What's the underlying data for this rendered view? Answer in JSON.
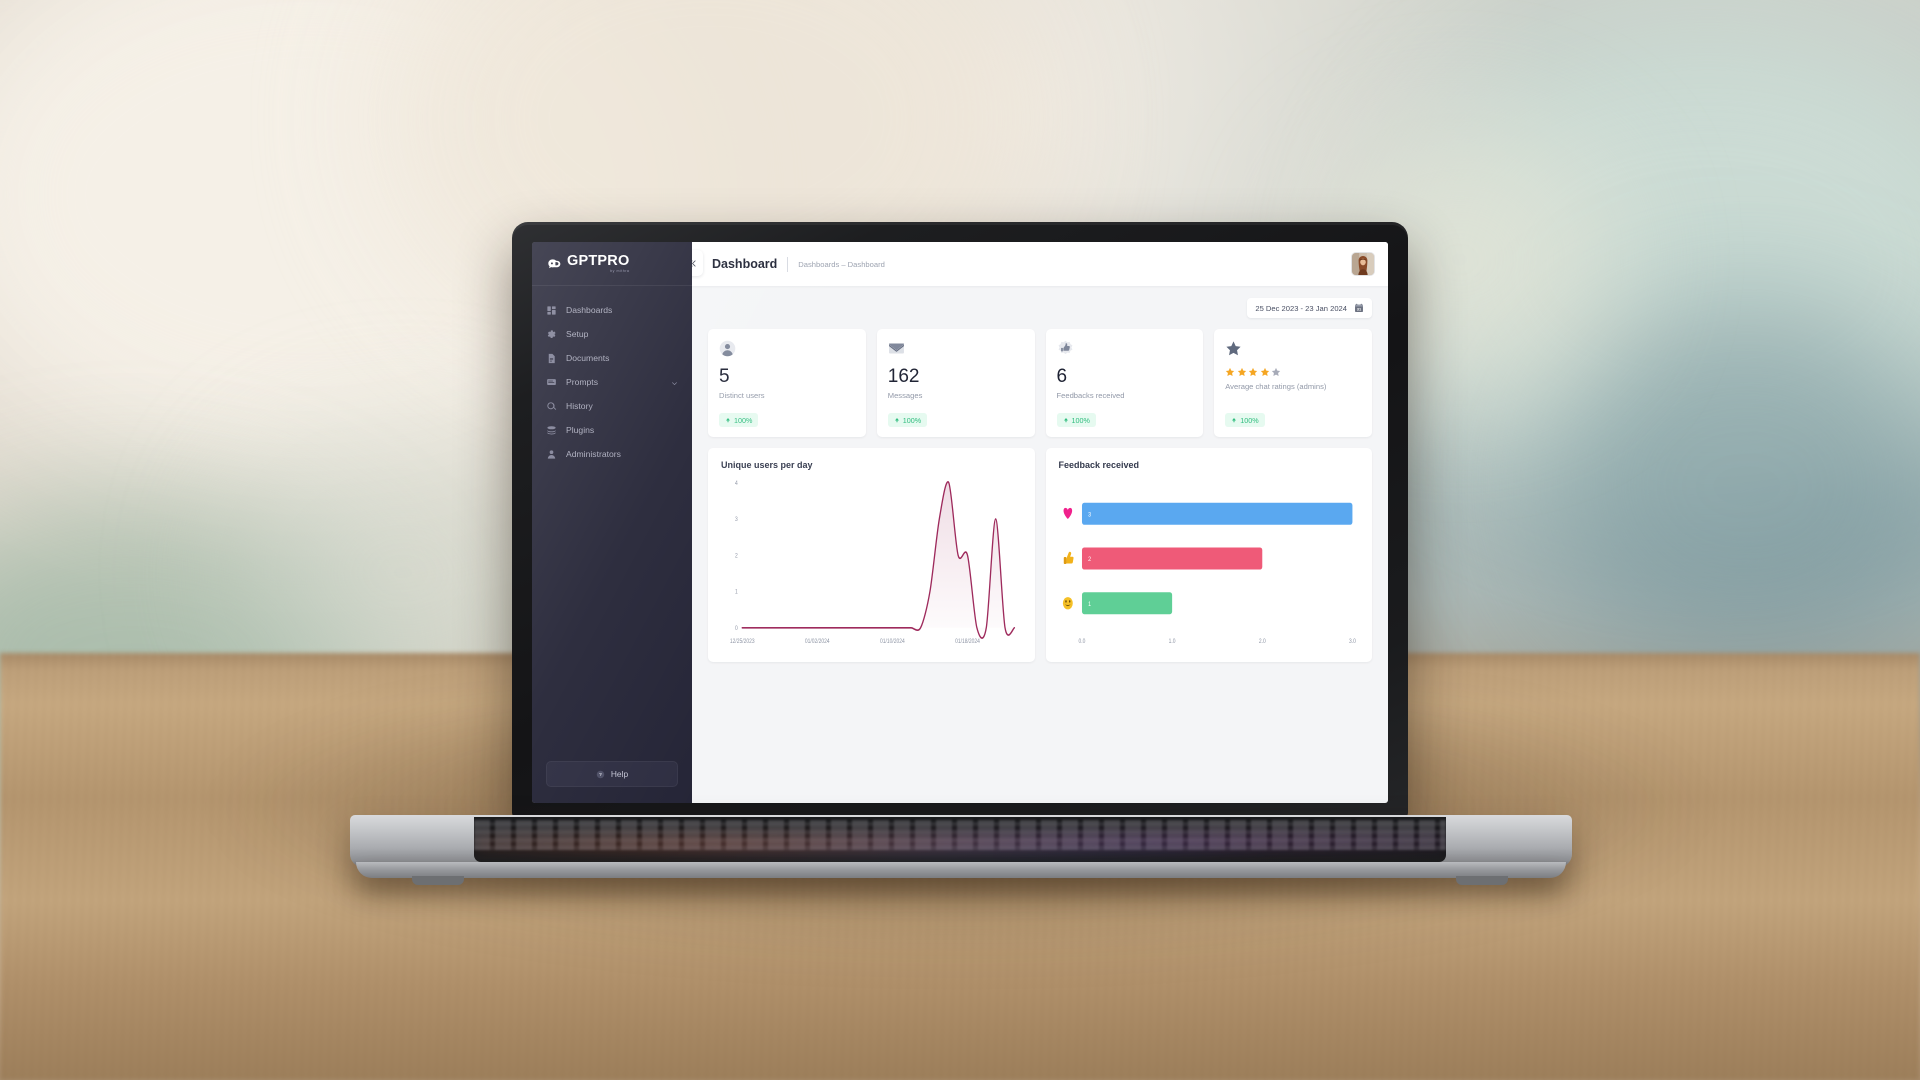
{
  "brand": {
    "name": "GPTPRO",
    "subtitle": "by mithra",
    "mark_icon": "chat-bubble-logo-icon"
  },
  "sidebar": {
    "items": [
      {
        "label": "Dashboards",
        "icon": "grid-icon",
        "chevron": false
      },
      {
        "label": "Setup",
        "icon": "gear-icon",
        "chevron": false
      },
      {
        "label": "Documents",
        "icon": "document-icon",
        "chevron": false
      },
      {
        "label": "Prompts",
        "icon": "message-icon",
        "chevron": true
      },
      {
        "label": "History",
        "icon": "search-icon",
        "chevron": false
      },
      {
        "label": "Plugins",
        "icon": "layers-icon",
        "chevron": false
      },
      {
        "label": "Administrators",
        "icon": "user-icon",
        "chevron": false
      }
    ],
    "help": {
      "label": "Help",
      "icon": "question-circle-icon"
    }
  },
  "header": {
    "collapse_icon": "double-chevron-left-icon",
    "title": "Dashboard",
    "breadcrumb": "Dashboards – Dashboard",
    "avatar_name": "user-avatar"
  },
  "toolbar": {
    "date_range": "25 Dec 2023 - 23 Jan 2024",
    "calendar_icon": "calendar-icon"
  },
  "stat_cards": [
    {
      "icon": "user-circle-icon",
      "value": "5",
      "label": "Distinct users",
      "delta": "100%",
      "delta_icon": "arrow-up-icon"
    },
    {
      "icon": "envelope-icon",
      "value": "162",
      "label": "Messages",
      "delta": "100%",
      "delta_icon": "arrow-up-icon"
    },
    {
      "icon": "thumbs-up-icon",
      "value": "6",
      "label": "Feedbacks received",
      "delta": "100%",
      "delta_icon": "arrow-up-icon"
    },
    {
      "icon": "star-icon",
      "value": "",
      "label": "Average chat ratings (admins)",
      "delta": "100%",
      "delta_icon": "arrow-up-icon",
      "rating": {
        "filled": 4,
        "total": 5,
        "filled_color": "#f5a623",
        "empty_color": "#a7abb8"
      }
    }
  ],
  "colors": {
    "sidebar_bg": "#232335",
    "page_bg": "#f4f5f7",
    "accent_line": "#9e2a5c",
    "badge_green": "#2fbd7e",
    "bar_blue": "#5aa8f0",
    "bar_pink": "#ef5a78",
    "bar_green": "#5fcf96"
  },
  "chart_data": [
    {
      "type": "line",
      "title": "Unique users per day",
      "xlabel": "",
      "ylabel": "",
      "ylim": [
        0,
        4
      ],
      "yticks": [
        "0",
        "1",
        "2",
        "3",
        "4"
      ],
      "xticks": [
        "12/25/2023",
        "01/02/2024",
        "01/10/2024",
        "01/18/2024"
      ],
      "grid": false,
      "line_color": "#9e2a5c",
      "fill": true,
      "x": [
        "12/25/2023",
        "12/26/2023",
        "12/27/2023",
        "12/28/2023",
        "12/29/2023",
        "12/30/2023",
        "12/31/2023",
        "01/01/2024",
        "01/02/2024",
        "01/03/2024",
        "01/04/2024",
        "01/05/2024",
        "01/06/2024",
        "01/07/2024",
        "01/08/2024",
        "01/09/2024",
        "01/10/2024",
        "01/11/2024",
        "01/12/2024",
        "01/13/2024",
        "01/14/2024",
        "01/15/2024",
        "01/16/2024",
        "01/17/2024",
        "01/18/2024",
        "01/19/2024",
        "01/20/2024",
        "01/21/2024",
        "01/22/2024",
        "01/23/2024"
      ],
      "values": [
        0,
        0,
        0,
        0,
        0,
        0,
        0,
        0,
        0,
        0,
        0,
        0,
        0,
        0,
        0,
        0,
        0,
        0,
        0,
        0,
        1,
        3,
        4,
        2,
        2,
        0,
        0,
        3,
        0,
        0
      ]
    },
    {
      "type": "bar",
      "orientation": "horizontal",
      "title": "Feedback received",
      "categories": [
        "heart",
        "thumbs-up",
        "smile"
      ],
      "category_icons": [
        "heart-emoji",
        "thumbs-up-emoji",
        "smile-emoji"
      ],
      "values": [
        3,
        2,
        1
      ],
      "bar_colors": [
        "#5aa8f0",
        "#ef5a78",
        "#5fcf96"
      ],
      "xlim": [
        0,
        3
      ],
      "xticks": [
        "0.0",
        "1.0",
        "2.0",
        "3.0"
      ],
      "grid": false
    }
  ]
}
